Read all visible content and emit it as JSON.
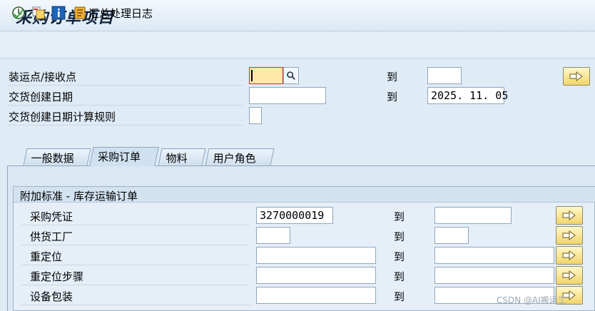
{
  "title": "采购订单项目",
  "toolbar": {
    "execute_icon": "execute-clock-icon",
    "copy_icon": "copy-variant-icon",
    "info_icon": "info-icon",
    "log_icon": "log-icon",
    "log_label": "汇总处理日志"
  },
  "header_fields": {
    "shipping_point": {
      "label": "装运点/接收点",
      "value": "",
      "to_label": "到",
      "to_value": ""
    },
    "delivery_date": {
      "label": "交货创建日期",
      "value": "",
      "to_label": "到",
      "to_value": "2025. 11. 05"
    },
    "date_rule": {
      "label": "交货创建日期计算规则",
      "value": ""
    }
  },
  "tabs": [
    {
      "label": "一般数据",
      "active": false
    },
    {
      "label": "采购订单",
      "active": true
    },
    {
      "label": "物料",
      "active": false
    },
    {
      "label": "用户角色",
      "active": false
    }
  ],
  "group": {
    "title": "附加标准 - 库存运输订单",
    "rows": [
      {
        "label": "采购凭证",
        "from": "3270000019",
        "to_label": "到",
        "to": ""
      },
      {
        "label": "供货工厂",
        "from": "",
        "to_label": "到",
        "to": ""
      },
      {
        "label": "重定位",
        "from": "",
        "to_label": "到",
        "to": ""
      },
      {
        "label": "重定位步骤",
        "from": "",
        "to_label": "到",
        "to": ""
      },
      {
        "label": "设备包装",
        "from": "",
        "to_label": "到",
        "to": ""
      }
    ]
  },
  "watermark": "CSDN @AI搬运工"
}
